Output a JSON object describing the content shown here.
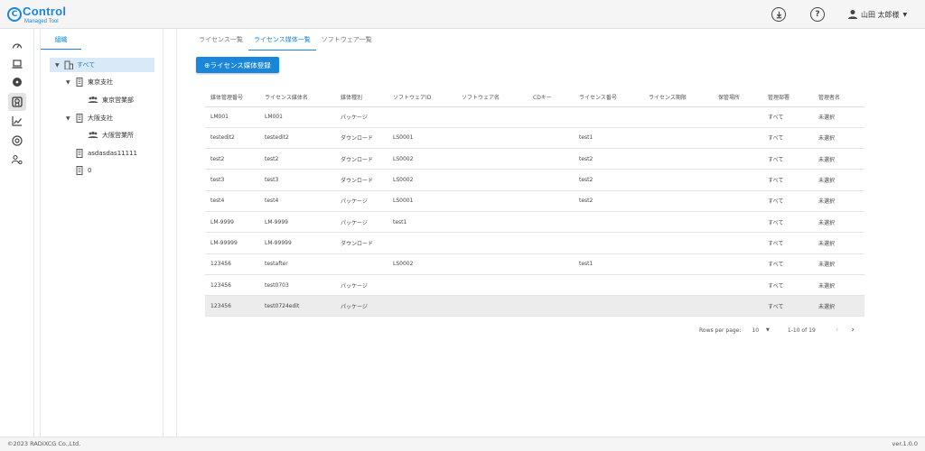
{
  "header": {
    "logo_main": "Control",
    "logo_sub": "Managed Tool",
    "download_icon": "download-circle-icon",
    "help_icon": "help-circle-icon",
    "user_name": "山田 太郎様"
  },
  "rail": {
    "items": [
      {
        "icon": "dashboard-icon"
      },
      {
        "icon": "computer-icon"
      },
      {
        "icon": "disc-icon"
      },
      {
        "icon": "license-badge-icon",
        "active": true
      },
      {
        "icon": "analytics-chart-icon"
      },
      {
        "icon": "support-icon"
      },
      {
        "icon": "user-settings-icon"
      }
    ]
  },
  "tree": {
    "tab_label": "組織",
    "nodes": [
      {
        "label": "すべて",
        "level": 0,
        "selected": true
      },
      {
        "label": "東京支社",
        "level": 1
      },
      {
        "label": "東京営業部",
        "level": 2
      },
      {
        "label": "大阪支社",
        "level": 1
      },
      {
        "label": "大阪営業所",
        "level": 2
      },
      {
        "label": "asdasdas11111",
        "level": 1
      },
      {
        "label": "0",
        "level": 1
      }
    ]
  },
  "main": {
    "tabs": [
      "ライセンス一覧",
      "ライセンス媒体一覧",
      "ソフトウェア一覧"
    ],
    "active_tab": 1,
    "register_button": "⊕ライセンス媒体登録",
    "columns": [
      "媒体管理番号",
      "ライセンス媒体名",
      "媒体種別",
      "ソフトウェアID",
      "ソフトウェア名",
      "CDキー",
      "ライセンス番号",
      "ライセンス期限",
      "保管場所",
      "管理部署",
      "管理者名"
    ],
    "rows": [
      [
        "LM001",
        "LM001",
        "パッケージ",
        "",
        "",
        "",
        "",
        "",
        "",
        "すべて",
        "未選択"
      ],
      [
        "testedit2",
        "testedit2",
        "ダウンロード",
        "LS0001",
        "",
        "",
        "test1",
        "",
        "",
        "すべて",
        "未選択"
      ],
      [
        "test2",
        "test2",
        "ダウンロード",
        "LS0002",
        "",
        "",
        "test2",
        "",
        "",
        "すべて",
        "未選択"
      ],
      [
        "test3",
        "test3",
        "ダウンロード",
        "LS0002",
        "",
        "",
        "test2",
        "",
        "",
        "すべて",
        "未選択"
      ],
      [
        "test4",
        "test4",
        "パッケージ",
        "LS0001",
        "",
        "",
        "test2",
        "",
        "",
        "すべて",
        "未選択"
      ],
      [
        "LM-9999",
        "LM-9999",
        "パッケージ",
        "test1",
        "",
        "",
        "",
        "",
        "",
        "すべて",
        "未選択"
      ],
      [
        "LM-99999",
        "LM-99999",
        "ダウンロード",
        "",
        "",
        "",
        "",
        "",
        "",
        "すべて",
        "未選択"
      ],
      [
        "123456",
        "testafter",
        "",
        "LS0002",
        "",
        "",
        "test1",
        "",
        "",
        "すべて",
        "未選択"
      ],
      [
        "123456",
        "test0703",
        "パッケージ",
        "",
        "",
        "",
        "",
        "",
        "",
        "すべて",
        "未選択"
      ],
      [
        "123456",
        "test0724edit",
        "パッケージ",
        "",
        "",
        "",
        "",
        "",
        "",
        "すべて",
        "未選択"
      ]
    ],
    "highlighted_row": 9,
    "pager": {
      "rows_per_page_label": "Rows per page:",
      "rows_per_page": "10",
      "range": "1-10 of 19",
      "prev": "‹",
      "next": "›"
    }
  },
  "footer": {
    "copyright": "©2023 RADIXCG Co.,Ltd.",
    "version": "ver.1.0.0"
  },
  "colors": {
    "accent": "#1a86d9",
    "selected_bg": "#d9e9f8",
    "row_highlight": "#ececec"
  }
}
